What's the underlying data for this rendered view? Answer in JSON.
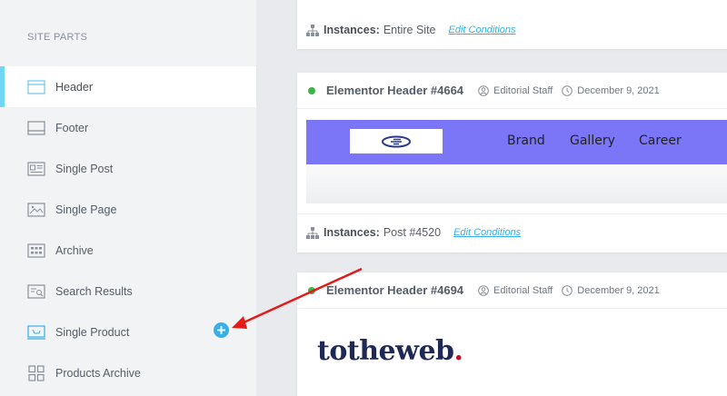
{
  "sidebar": {
    "heading": "SITE PARTS",
    "items": [
      {
        "label": "Header",
        "icon": "header-icon",
        "active": true
      },
      {
        "label": "Footer",
        "icon": "footer-icon"
      },
      {
        "label": "Single Post",
        "icon": "single-post-icon"
      },
      {
        "label": "Single Page",
        "icon": "single-page-icon"
      },
      {
        "label": "Archive",
        "icon": "archive-icon"
      },
      {
        "label": "Search Results",
        "icon": "search-results-icon"
      },
      {
        "label": "Single Product",
        "icon": "single-product-icon"
      },
      {
        "label": "Products Archive",
        "icon": "products-archive-icon"
      }
    ],
    "add_icon": "plus-icon"
  },
  "cards": {
    "top": {
      "instances_label": "Instances:",
      "instances_value": "Entire Site",
      "edit_label": "Edit Conditions"
    },
    "header1": {
      "title": "Elementor Header #4664",
      "author": "Editorial Staff",
      "date": "December 9, 2021",
      "status_color": "#39b54a",
      "preview": {
        "nav": [
          "Brand",
          "Gallery",
          "Career"
        ],
        "bar_color": "#7b76f7"
      },
      "instances_label": "Instances:",
      "instances_value": "Post #4520",
      "edit_label": "Edit Conditions"
    },
    "header2": {
      "title": "Elementor Header #4694",
      "author": "Editorial Staff",
      "date": "December 9, 2021",
      "status_color": "#39b54a",
      "brand_text": "totheweb",
      "brand_dot": "."
    }
  },
  "colors": {
    "accent": "#39b0e5",
    "active_indicator": "#71d7f7",
    "annotation_arrow": "#e31b1b"
  }
}
